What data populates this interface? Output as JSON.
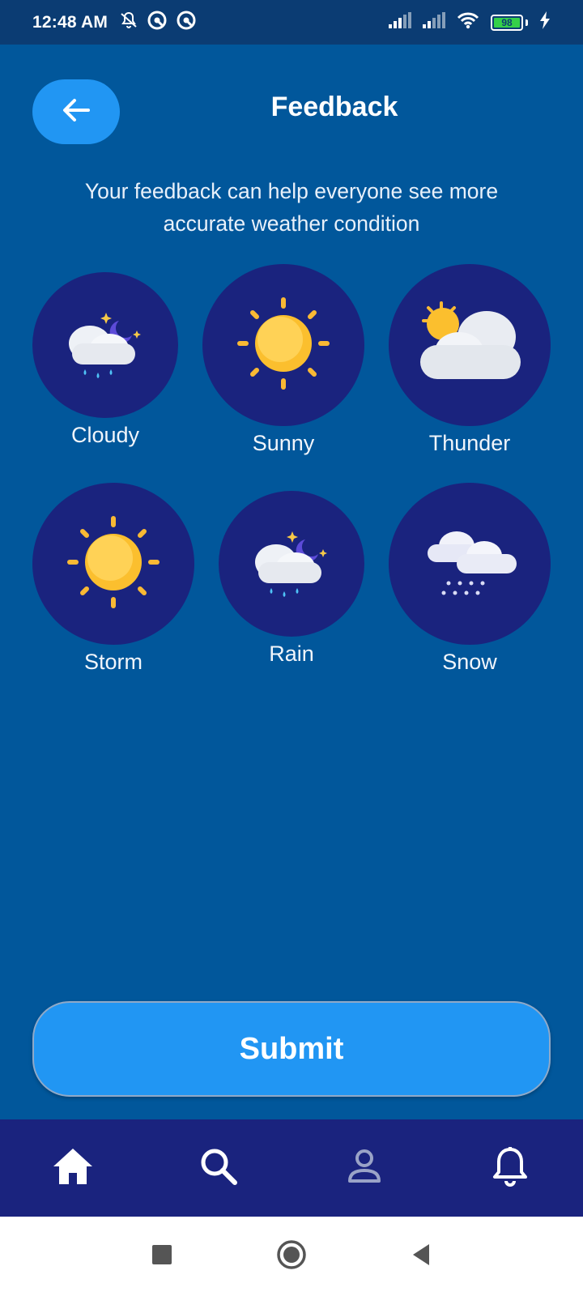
{
  "status_bar": {
    "time": "12:48 AM",
    "icons": [
      "notifications-off-icon",
      "vpn-icon",
      "vpn-icon"
    ],
    "battery_level": "98",
    "right_icons": [
      "signal-icon",
      "signal-icon",
      "wifi-icon",
      "battery-icon",
      "charging-icon"
    ]
  },
  "header": {
    "back_icon": "arrow-left-icon",
    "title": "Feedback"
  },
  "subtitle": "Your feedback can help everyone see more accurate weather condition",
  "weather_options": [
    {
      "label": "Cloudy",
      "icon": "cloud-moon-rain-icon"
    },
    {
      "label": "Sunny",
      "icon": "sun-icon"
    },
    {
      "label": "Thunder",
      "icon": "sun-behind-cloud-icon"
    },
    {
      "label": "Storm",
      "icon": "sun-icon"
    },
    {
      "label": "Rain",
      "icon": "cloud-moon-rain-icon"
    },
    {
      "label": "Snow",
      "icon": "cloud-snow-icon"
    }
  ],
  "submit_label": "Submit",
  "bottom_nav": [
    "home-icon",
    "search-icon",
    "profile-icon",
    "bell-icon"
  ],
  "system_nav": [
    "recents-icon",
    "home-circle-icon",
    "back-triangle-icon"
  ],
  "colors": {
    "background": "#01579B",
    "status_bar": "#0B3C73",
    "accent": "#2196F3",
    "circle": "#1A237E",
    "nav": "#1A237E"
  }
}
